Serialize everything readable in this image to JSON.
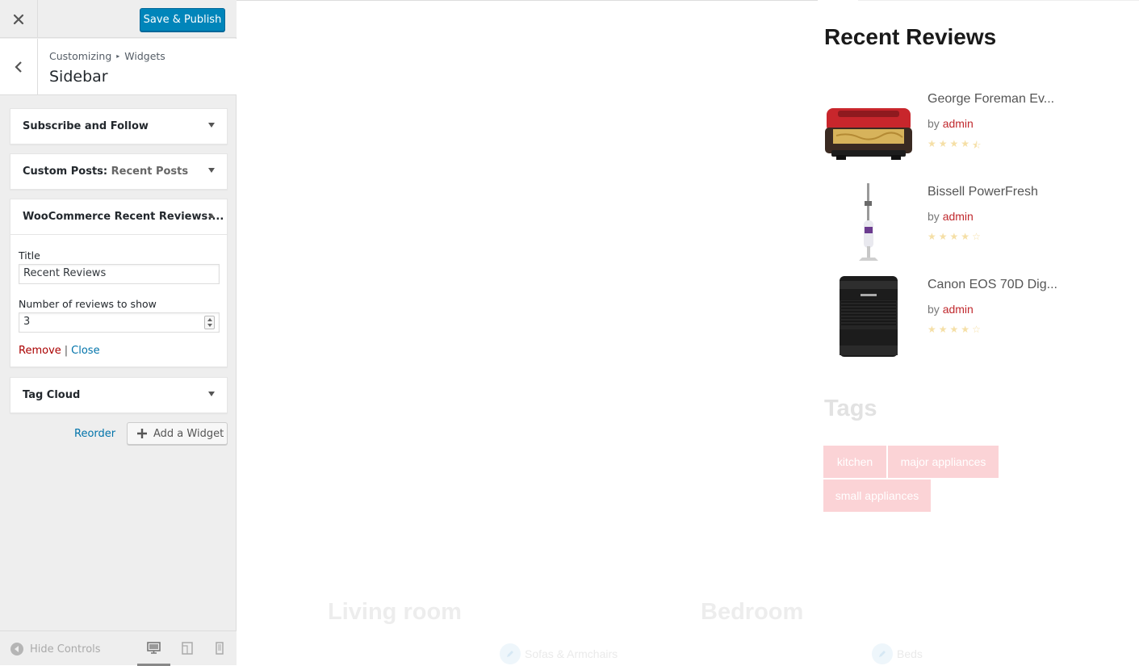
{
  "controls": {
    "close_label": "×",
    "save_label": "Save & Publish",
    "breadcrumb": [
      "Customizing",
      "Widgets"
    ],
    "section_title": "Sidebar",
    "widgets": [
      {
        "title": "Subscribe and Follow",
        "in": ""
      },
      {
        "title": "Custom Posts: ",
        "in": "Recent Posts"
      },
      {
        "title": "WooCommerce Recent Reviews:...",
        "in": ""
      },
      {
        "title": "Tag Cloud",
        "in": ""
      }
    ],
    "form": {
      "title_label": "Title",
      "title_value": "Recent Reviews",
      "count_label": "Number of reviews to show",
      "count_value": "3",
      "remove_label": "Remove",
      "pipe": "|",
      "close_label": "Close"
    },
    "reorder_label": "Reorder",
    "add_widget_label": "Add a Widget",
    "hide_controls_label": "Hide Controls"
  },
  "preview": {
    "recent_reviews_title": "Recent Reviews",
    "reviews": [
      {
        "name": "George Foreman Ev...",
        "by": "by ",
        "author": "admin",
        "rating": 4.5
      },
      {
        "name": "Bissell PowerFresh",
        "by": "by ",
        "author": "admin",
        "rating": 4
      },
      {
        "name": "Canon EOS 70D Dig...",
        "by": "by ",
        "author": "admin",
        "rating": 4
      }
    ],
    "tags_title": "Tags",
    "tags": [
      "kitchen",
      "major appliances",
      "small appliances"
    ],
    "categories": [
      {
        "title": "Living room",
        "link": "Sofas & Armchairs"
      },
      {
        "title": "Bedroom",
        "link": "Beds"
      }
    ]
  },
  "colors": {
    "primary_button": "#0085ba",
    "link": "#0073aa",
    "remove": "#aa0000",
    "author": "#c0282d",
    "tag_bg": "#fbd3d6"
  }
}
